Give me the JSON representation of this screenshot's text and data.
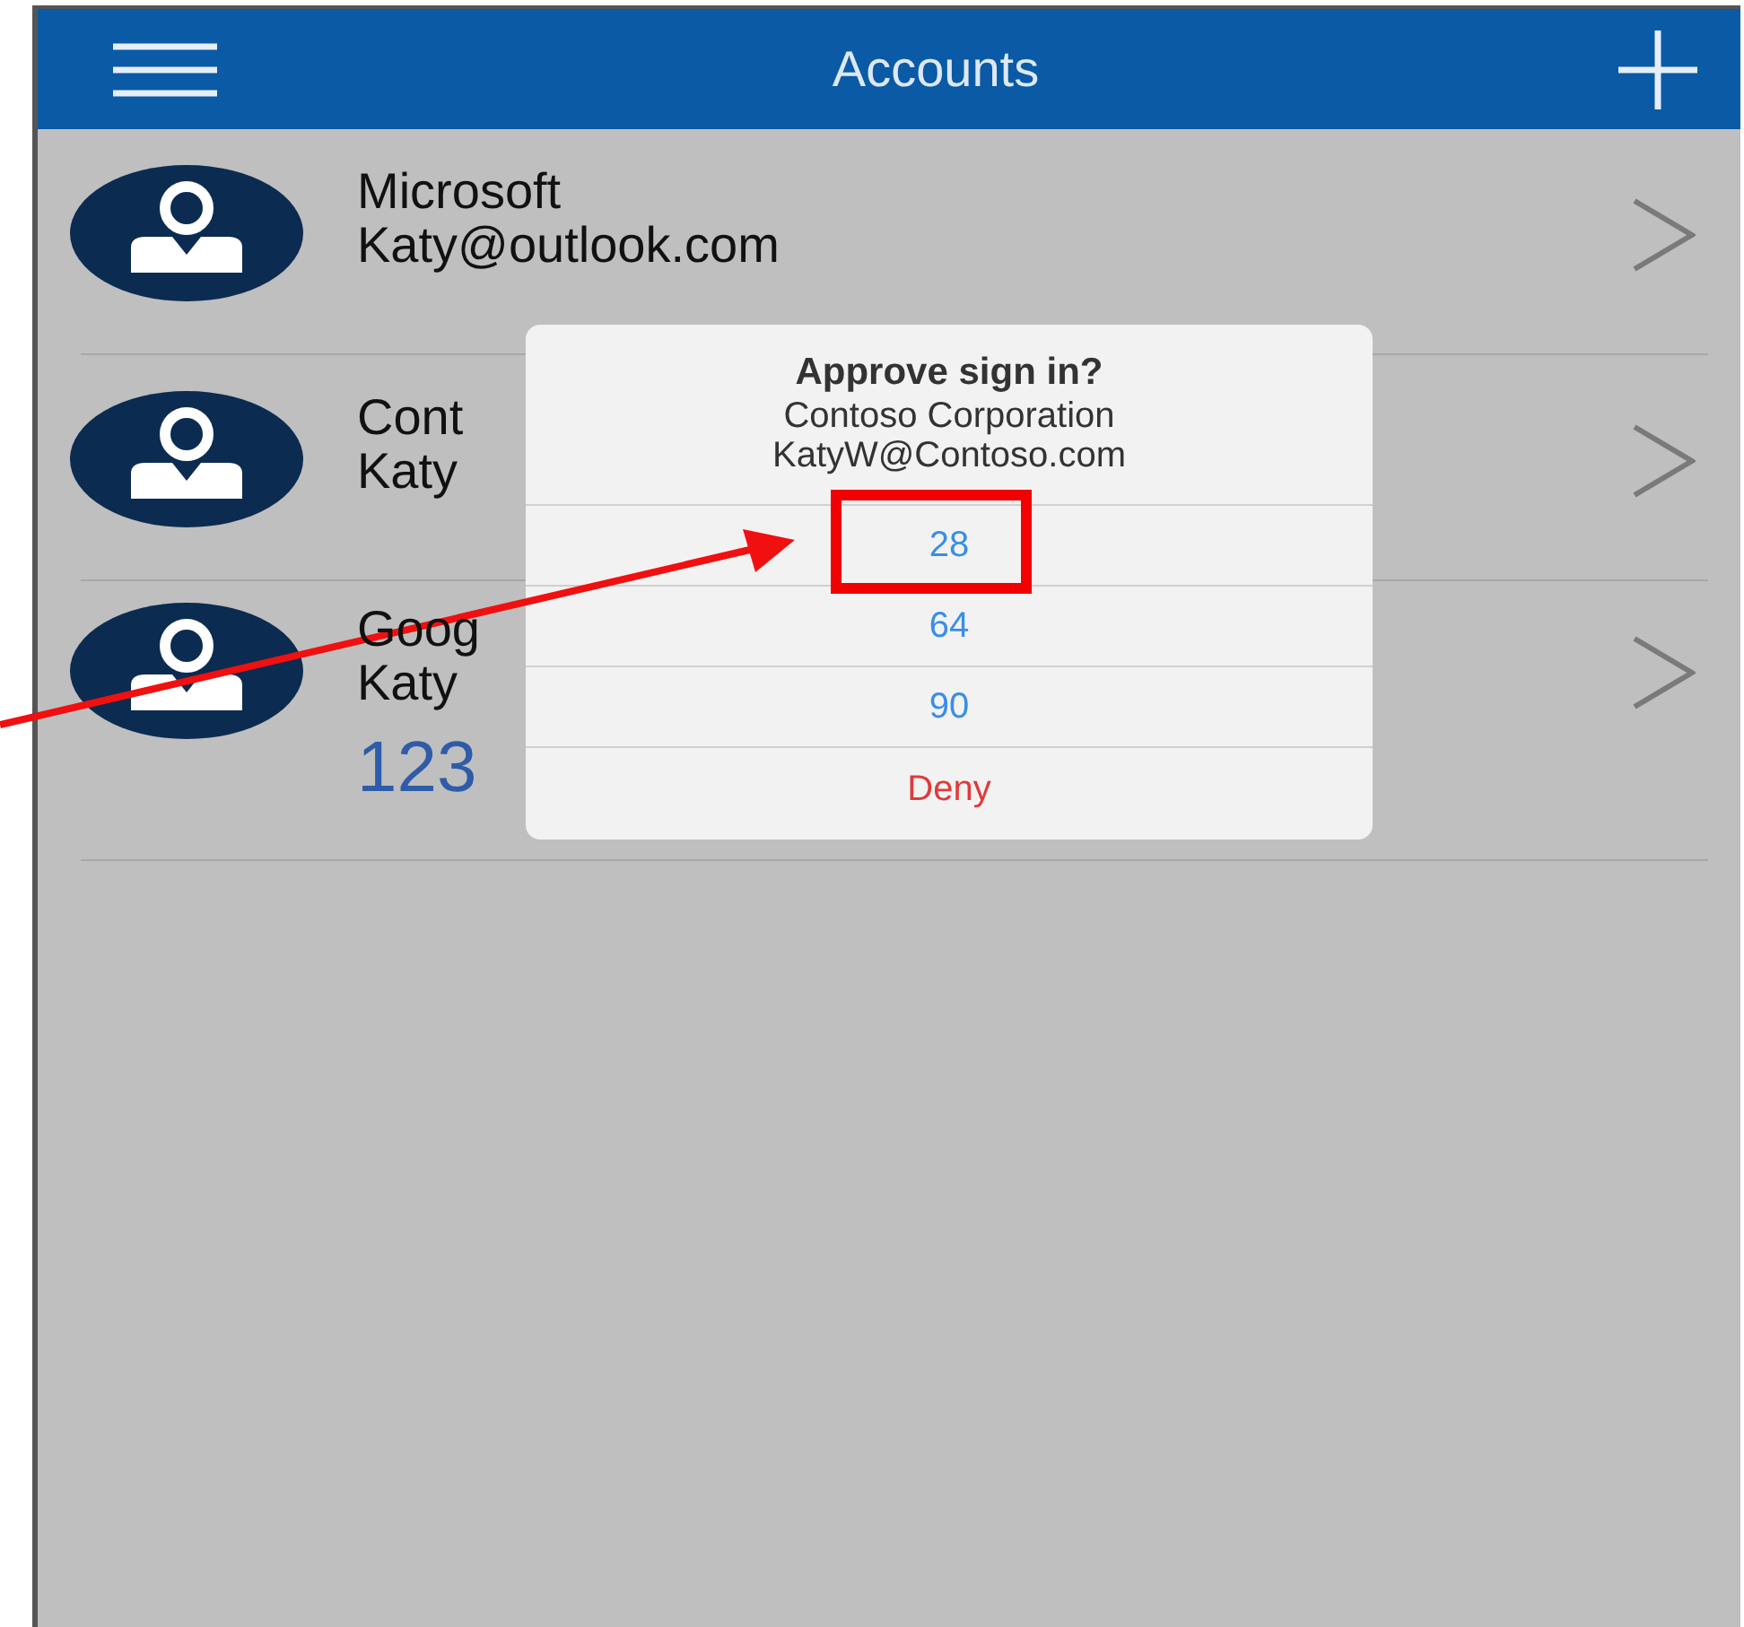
{
  "header": {
    "title": "Accounts"
  },
  "accounts": [
    {
      "name": "Microsoft",
      "email": "Katy@outlook.com"
    },
    {
      "name": "Cont",
      "email": "Katy"
    },
    {
      "name": "Goog",
      "email": "Katy",
      "code": "123"
    }
  ],
  "dialog": {
    "title": "Approve sign in?",
    "lines": [
      "Contoso Corporation",
      "KatyW@Contoso.com"
    ],
    "options": [
      {
        "label": "28",
        "kind": "number",
        "highlighted": true
      },
      {
        "label": "64",
        "kind": "number",
        "highlighted": false
      },
      {
        "label": "90",
        "kind": "number",
        "highlighted": false
      },
      {
        "label": "Deny",
        "kind": "deny",
        "highlighted": false
      }
    ]
  }
}
